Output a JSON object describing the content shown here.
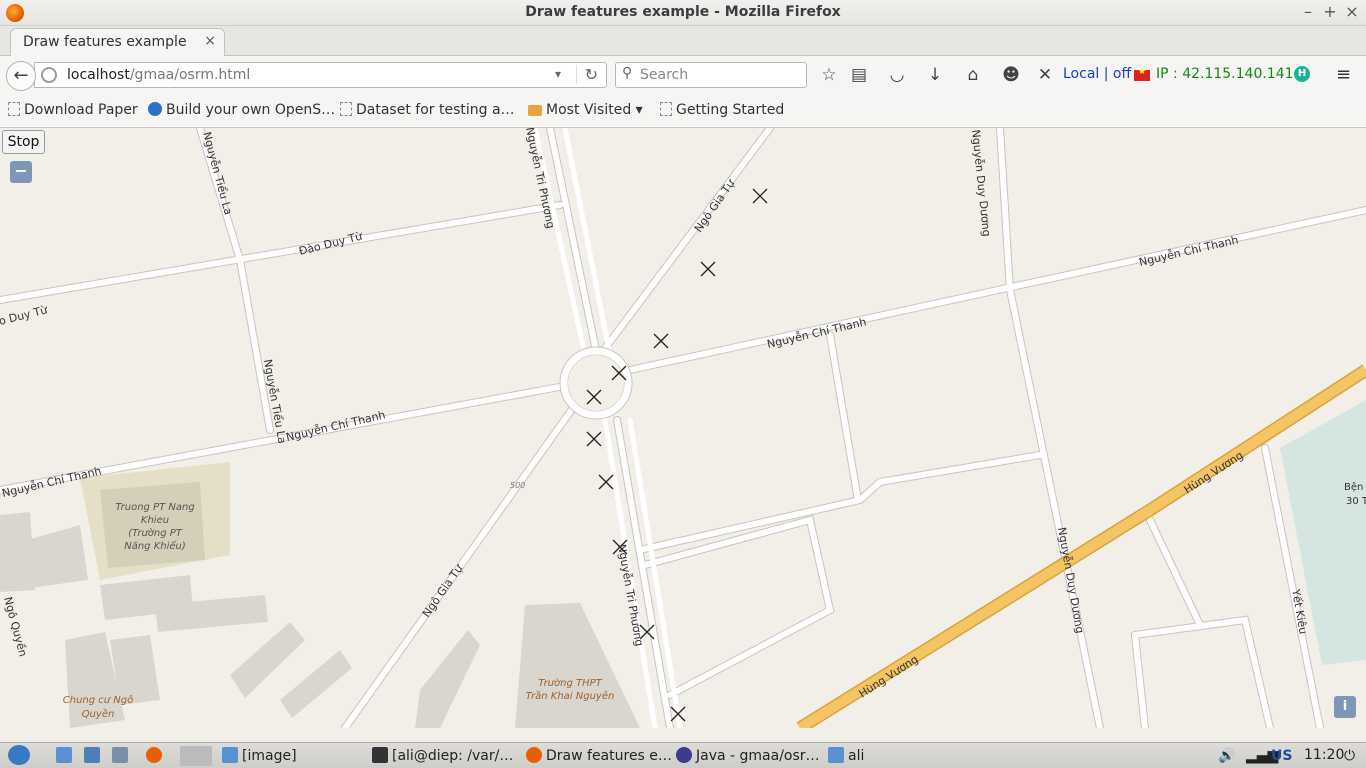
{
  "window": {
    "title": "Draw features example - Mozilla Firefox"
  },
  "tab": {
    "label": "Draw features example"
  },
  "nav": {
    "url_host": "localhost",
    "url_path": "/gmaa/osrm.html",
    "search_placeholder": "Search",
    "proxy_status": "Local | off",
    "ip_label": "IP : 42.115.140.141",
    "h_badge": "H"
  },
  "bookmarks": [
    {
      "label": "Download Paper",
      "icon": "page-icon"
    },
    {
      "label": "Build your own OpenS…",
      "icon": "globe-icon"
    },
    {
      "label": "Dataset for testing a…",
      "icon": "page-icon"
    },
    {
      "label": "Most Visited",
      "icon": "folder-icon"
    },
    {
      "label": "Getting Started",
      "icon": "page-icon"
    }
  ],
  "map": {
    "stop_label": "Stop",
    "zoom_out_label": "−",
    "zoom_in_label": "+",
    "info_label": "i",
    "roads": [
      "Nguyễn Tiểu La",
      "Đào Duy Từ",
      "o Duy Từ",
      "Nguyễn Tri Phương",
      "Ngô Gia Tự",
      "Nguyễn Duy Dương",
      "Nguyễn Chí Thanh",
      "Hùng Vương",
      "Yết Kiêu",
      "Ngô Quyền"
    ],
    "places": [
      "Truong PT Nang",
      "Khieu",
      "(Trường PT",
      "Năng Khiếu)",
      "Chung cư Ngô",
      "Quyền",
      "Trường THPT",
      "Trần Khai Nguyên",
      "Bện",
      "30 T",
      "500"
    ]
  },
  "taskbar": {
    "items": [
      "[image]",
      "[ali@diep: /var/…",
      "Draw features e…",
      "Java - gmaa/osr…",
      "ali"
    ],
    "keyboard": "US",
    "clock": "11:20"
  }
}
